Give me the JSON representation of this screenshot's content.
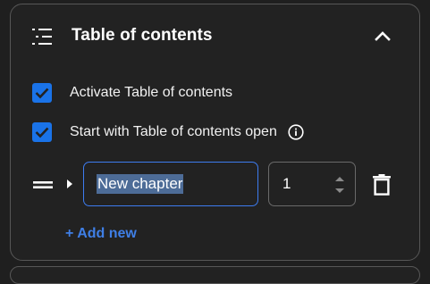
{
  "panel": {
    "title": "Table of contents",
    "icons": {
      "title_icon": "list-icon",
      "collapse_icon": "chevron-up-icon"
    }
  },
  "options": [
    {
      "label": "Activate Table of contents",
      "checked": true
    },
    {
      "label": "Start with Table of contents open",
      "checked": true,
      "info_icon": "info-icon"
    }
  ],
  "chapters": [
    {
      "name": "New chapter",
      "page": "1"
    }
  ],
  "actions": {
    "add_new_label": "+ Add new"
  },
  "colors": {
    "accent": "#1a73e8",
    "link": "#3f7fe6",
    "input_focus_border": "#3d7cf0",
    "text_selection": "#4d6c97",
    "panel_background": "#222222",
    "panel_border": "#575757"
  }
}
